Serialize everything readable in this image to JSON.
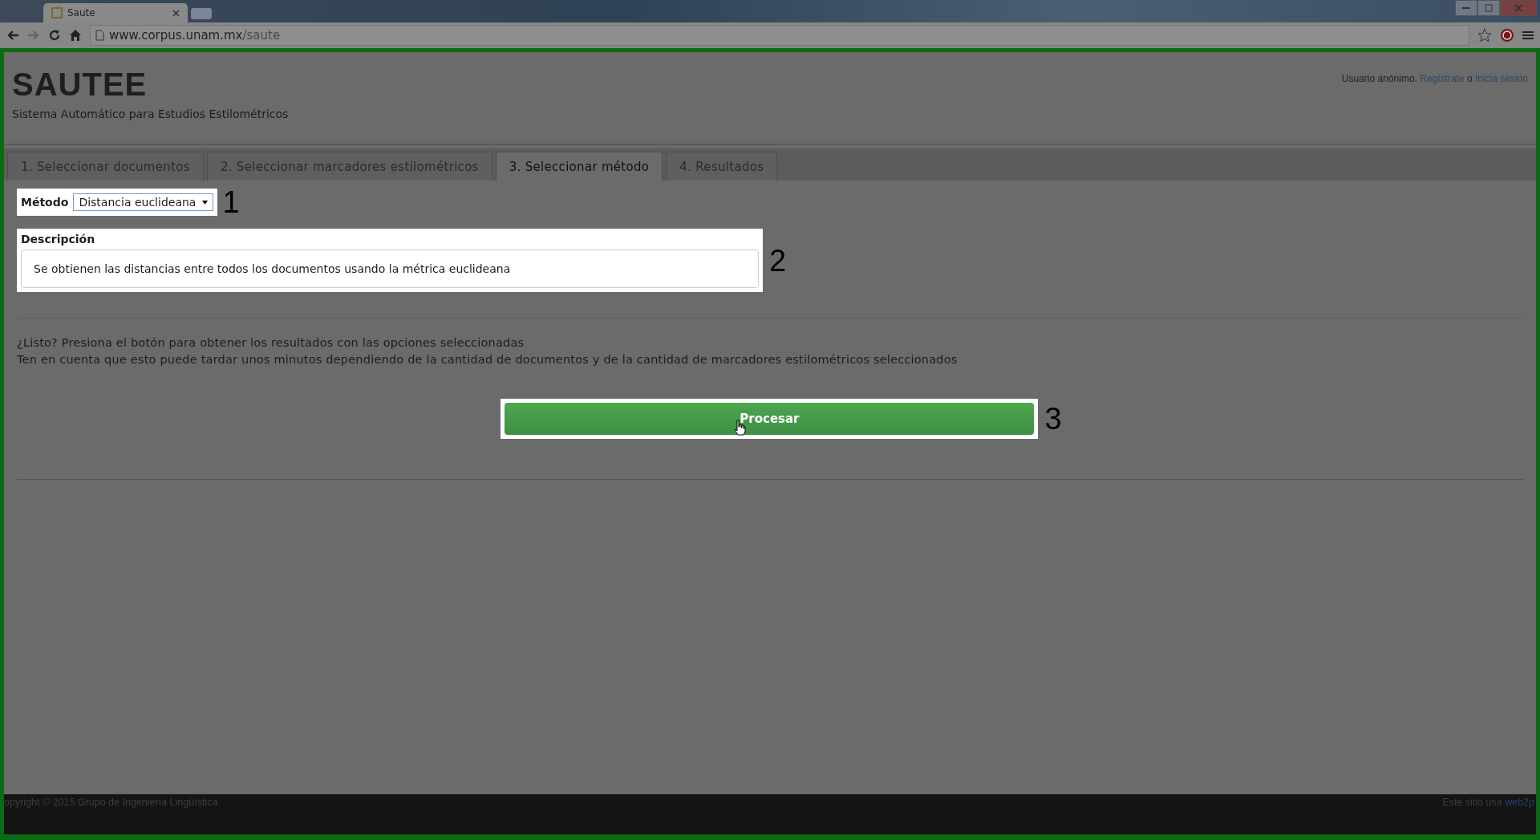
{
  "browser": {
    "tab_title": "Saute",
    "url_host": "www.corpus.unam.mx",
    "url_path": "/saute"
  },
  "header": {
    "title": "SAUTEE",
    "subtitle": "Sistema Automático para Estudios Estilométricos",
    "user_text": "Usuario anónimo.",
    "register_link": "Regístrate",
    "or_text": "o",
    "login_link": "Inicia sesión"
  },
  "tabs": [
    {
      "label": "1. Seleccionar documentos",
      "selected": false
    },
    {
      "label": "2. Seleccionar marcadores estilométricos",
      "selected": false
    },
    {
      "label": "3. Seleccionar método",
      "selected": true
    },
    {
      "label": "4. Resultados",
      "selected": false
    }
  ],
  "method": {
    "label": "Método",
    "value": "Distancia euclideana",
    "marker": "1"
  },
  "description": {
    "label": "Descripción",
    "text": "Se obtienen las distancias entre todos los documentos usando la métrica euclideana",
    "marker": "2"
  },
  "instructions": [
    "¿Listo? Presiona el botón para obtener los resultados con las opciones seleccionadas",
    "Ten en cuenta que esto puede tardar unos minutos dependiendo de la cantidad de documentos y de la cantidad de marcadores estilométricos seleccionados"
  ],
  "process_button": {
    "label": "Procesar",
    "marker": "3"
  },
  "footer": {
    "copyright": "opyright © 2015 Grupo de Ingeniería Lingüística",
    "powered_text": "Este sitio usa",
    "powered_link": "web2p"
  }
}
